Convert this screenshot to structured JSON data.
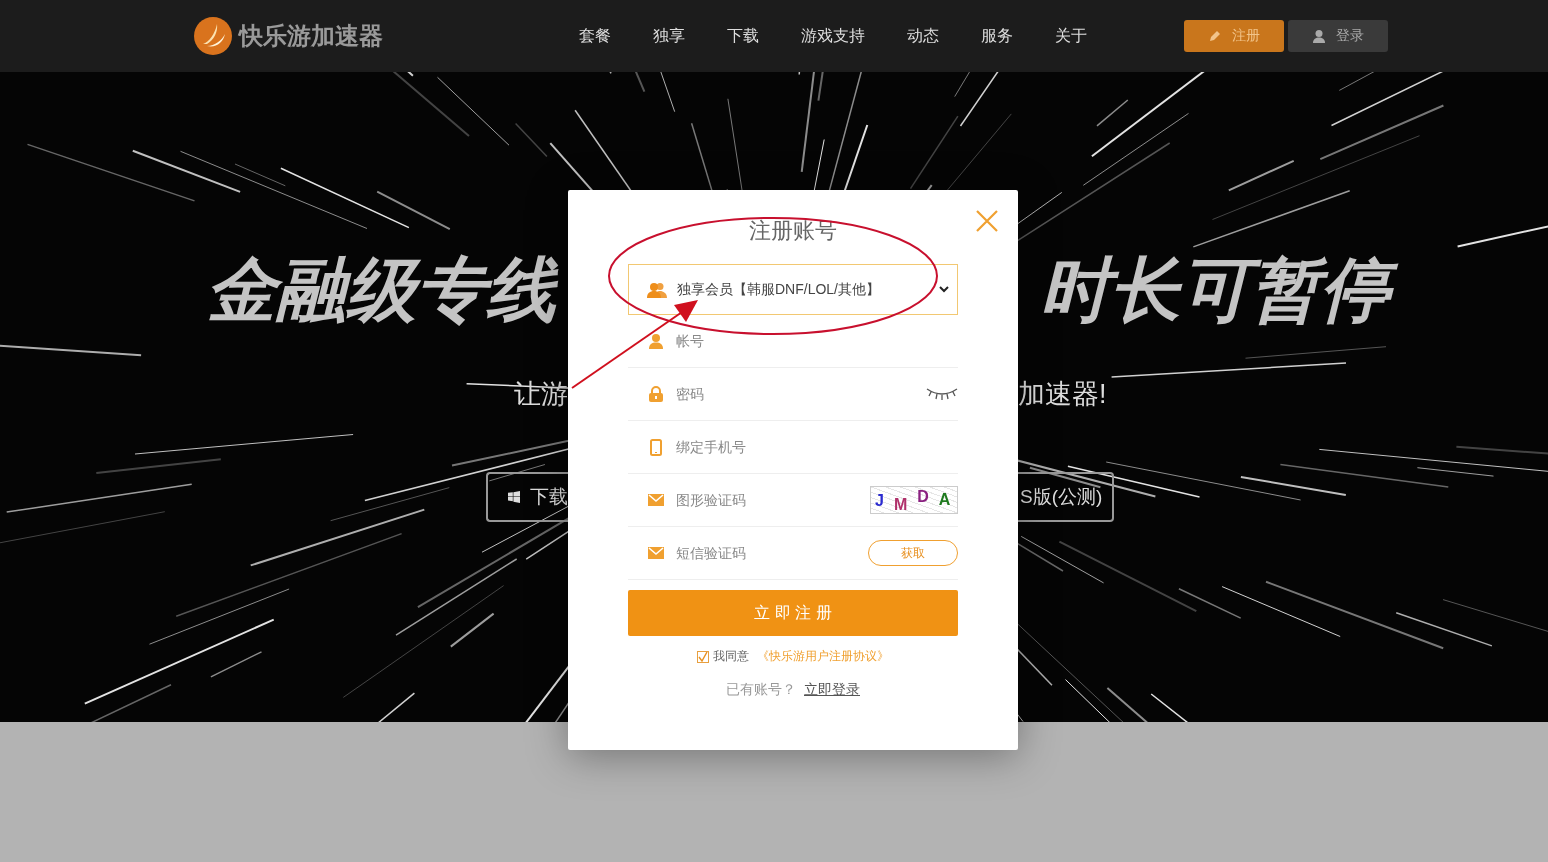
{
  "header": {
    "logo_text": "快乐游加速器",
    "nav": [
      "套餐",
      "独享",
      "下载",
      "游戏支持",
      "动态",
      "服务",
      "关于"
    ],
    "buttons": [
      {
        "kind": "register",
        "label": "注册"
      },
      {
        "kind": "login",
        "label": "登录"
      }
    ]
  },
  "hero": {
    "title_left": "金融级专线",
    "title_right": "时长可暂停",
    "subtitle_left": "让游",
    "subtitle_right": "加速器!",
    "download_left": "下载",
    "download_right": "S版(公测)"
  },
  "modal": {
    "title": "注册账号",
    "fields": [
      {
        "kind": "select",
        "value": "独享会员【韩服DNF/LOL/其他】"
      },
      {
        "kind": "account",
        "placeholder": "帐号"
      },
      {
        "kind": "password",
        "placeholder": "密码"
      },
      {
        "kind": "phone",
        "placeholder": "绑定手机号"
      },
      {
        "kind": "captcha",
        "placeholder": "图形验证码",
        "captcha": [
          {
            "char": "J",
            "color": "#2b2bd0"
          },
          {
            "char": "M",
            "color": "#b0306a"
          },
          {
            "char": "D",
            "color": "#8a2080"
          },
          {
            "char": "A",
            "color": "#1f7a1f"
          }
        ]
      },
      {
        "kind": "sms",
        "placeholder": "短信验证码",
        "button": "获取"
      }
    ],
    "submit": "立 即 注 册",
    "agreement": {
      "checked": true,
      "text": "我同意",
      "link": "《快乐游用户注册协议》"
    },
    "login_prompt": "已有账号？",
    "login_link": "立即登录"
  }
}
